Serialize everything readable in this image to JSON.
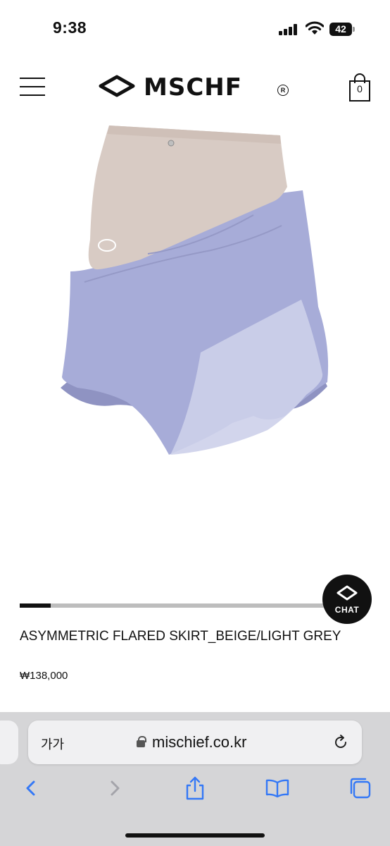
{
  "status_bar": {
    "time": "9:38",
    "battery_level": "42"
  },
  "header": {
    "brand": "MSCHF",
    "registered_mark": "R",
    "cart_count": "0"
  },
  "product": {
    "title": "ASYMMETRIC FLARED SKIRT_BEIGE/LIGHT GREY",
    "price": "₩138,000",
    "gallery_progress": 0.1
  },
  "chat": {
    "label": "CHAT"
  },
  "safari": {
    "text_size_label": "가가",
    "url": "mischief.co.kr"
  },
  "colors": {
    "accent": "#111111",
    "progress_track": "#bdbdbd",
    "safari_bar": "#d5d5d7",
    "ios_blue": "#3478f6",
    "skirt_beige": "#d8cbc4",
    "skirt_lavender": "#a7acd8"
  },
  "icons": [
    "signal-icon",
    "wifi-icon",
    "battery-icon",
    "menu-icon",
    "logo-eye-icon",
    "cart-icon",
    "chat-eye-icon",
    "lock-icon",
    "reload-icon",
    "back-icon",
    "forward-icon",
    "share-icon",
    "bookmarks-icon",
    "tabs-icon"
  ]
}
